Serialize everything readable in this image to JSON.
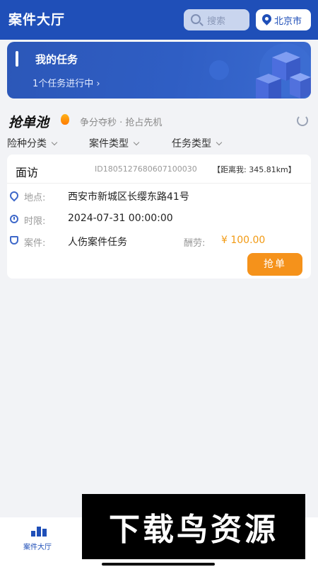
{
  "header": {
    "title": "案件大厅",
    "search_placeholder": "搜索",
    "city": "北京市"
  },
  "banner": {
    "title": "我的任务",
    "subtitle": "1个任务进行中 ›"
  },
  "pool": {
    "title": "抢单池",
    "slogan": "争分夺秒 · 抢占先机"
  },
  "filters": [
    "险种分类",
    "案件类型",
    "任务类型"
  ],
  "task": {
    "type": "面访",
    "id": "ID1805127680607100030",
    "distance": "【距离我: 345.81km】",
    "location_label": "地点:",
    "location": "西安市新城区长缨东路41号",
    "deadline_label": "时限:",
    "deadline": "2024-07-31 00:00:00",
    "case_label": "案件:",
    "case": "人伤案件任务",
    "reward_label": "酬劳:",
    "reward": "¥ 100.00",
    "grab_label": "抢单"
  },
  "tabbar": {
    "tab_label": "案件大厅"
  },
  "watermark": "下载鸟资源",
  "colors": {
    "primary": "#1f4fb8",
    "accent": "#f5921b"
  }
}
